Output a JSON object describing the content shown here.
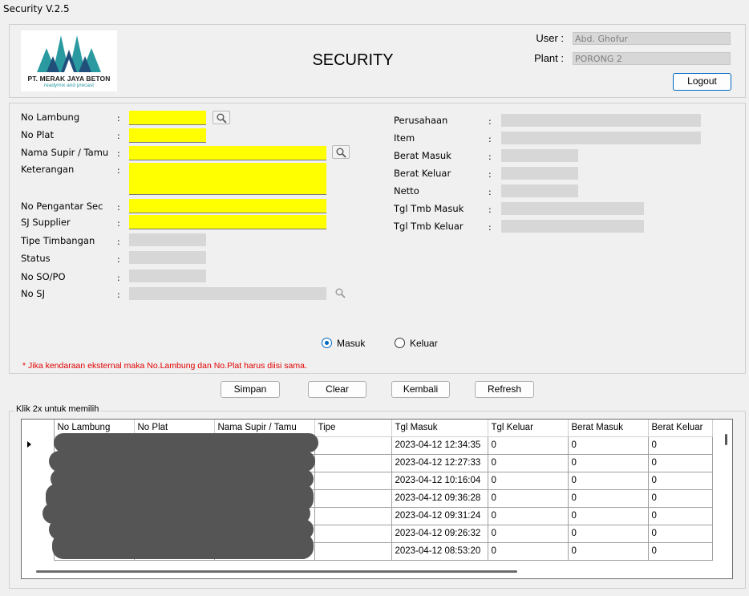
{
  "window": {
    "title": "Security V.2.5"
  },
  "header": {
    "logo": {
      "company": "PT. MERAK JAYA BETON",
      "tagline": "readymix and precast",
      "colors": {
        "teal": "#2a9aa0",
        "navy": "#1f4f7a"
      }
    },
    "title": "SECURITY",
    "user_label": "User :",
    "user_value": "Abd. Ghofur",
    "plant_label": "Plant :",
    "plant_value": "PORONG 2",
    "logout_label": "Logout"
  },
  "form": {
    "colon": ":",
    "left": {
      "no_lambung": "No Lambung",
      "no_plat": "No Plat",
      "nama_supir": "Nama Supir / Tamu",
      "keterangan": "Keterangan",
      "no_pengantar": "No Pengantar Sec",
      "sj_supplier": "SJ Supplier",
      "tipe_timbangan": "Tipe Timbangan",
      "status": "Status",
      "no_so_po": "No SO/PO",
      "no_sj": "No SJ"
    },
    "right": {
      "perusahaan": "Perusahaan",
      "item": "Item",
      "berat_masuk": "Berat Masuk",
      "berat_keluar": "Berat Keluar",
      "netto": "Netto",
      "tgl_tmb_masuk": "Tgl Tmb Masuk",
      "tgl_tmb_keluar": "Tgl Tmb Keluar"
    },
    "direction": {
      "masuk": "Masuk",
      "keluar": "Keluar",
      "selected": "Masuk"
    },
    "note": "* Jika kendaraan eksternal maka No.Lambung dan No.Plat harus diisi sama."
  },
  "actions": {
    "simpan": "Simpan",
    "clear": "Clear",
    "kembali": "Kembali",
    "refresh": "Refresh"
  },
  "grid": {
    "group_title": "Klik 2x untuk memilih",
    "columns": [
      "No Lambung",
      "No Plat",
      "Nama Supir / Tamu",
      "Tipe",
      "Tgl Masuk",
      "Tgl Keluar",
      "Berat Masuk",
      "Berat Keluar"
    ],
    "rows": [
      {
        "tgl_masuk": "2023-04-12 12:34:35",
        "tgl_keluar": "0",
        "berat_masuk": "0",
        "berat_keluar": "0"
      },
      {
        "tgl_masuk": "2023-04-12 12:27:33",
        "tgl_keluar": "0",
        "berat_masuk": "0",
        "berat_keluar": "0"
      },
      {
        "tgl_masuk": "2023-04-12 10:16:04",
        "tgl_keluar": "0",
        "berat_masuk": "0",
        "berat_keluar": "0"
      },
      {
        "tgl_masuk": "2023-04-12 09:36:28",
        "tgl_keluar": "0",
        "berat_masuk": "0",
        "berat_keluar": "0"
      },
      {
        "tgl_masuk": "2023-04-12 09:31:24",
        "tgl_keluar": "0",
        "berat_masuk": "0",
        "berat_keluar": "0"
      },
      {
        "tgl_masuk": "2023-04-12 09:26:32",
        "tgl_keluar": "0",
        "berat_masuk": "0",
        "berat_keluar": "0"
      },
      {
        "tgl_masuk": "2023-04-12 08:53:20",
        "tgl_keluar": "0",
        "berat_masuk": "0",
        "berat_keluar": "0"
      }
    ],
    "colors": {
      "field_yellow": "#ffff00",
      "field_grey": "#d7d7d7",
      "accent": "#0067c0",
      "note_red": "#e00000"
    }
  }
}
